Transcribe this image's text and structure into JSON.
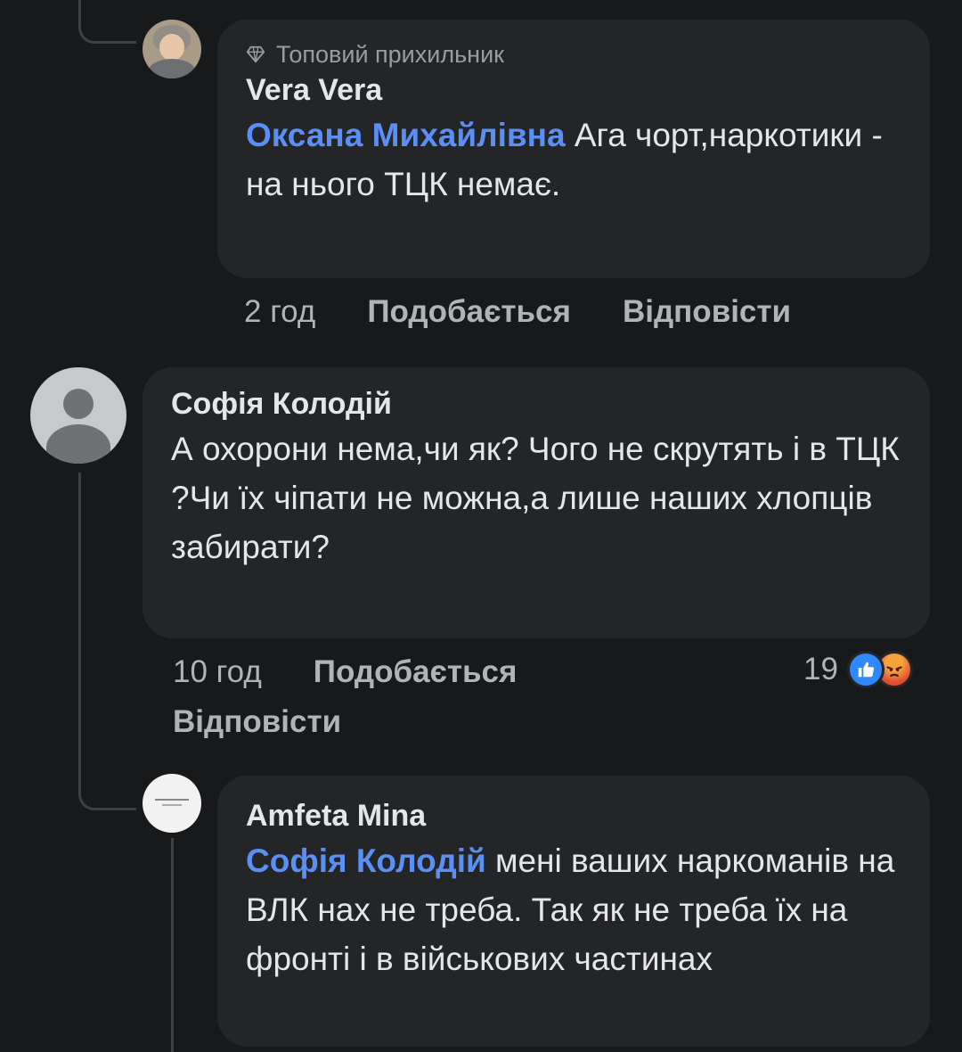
{
  "comments": [
    {
      "badge": "Топовий прихильник",
      "author": "Vera Vera",
      "mention": "Оксана Михайлівна",
      "text": " Ага чорт,наркотики  - на нього ТЦК немає.",
      "time": "2 год",
      "like_label": "Подобається",
      "reply_label": "Відповісти"
    },
    {
      "author": "Софія Колодій",
      "text": "А охорони нема,чи як? Чого не скрутять і в ТЦК ?Чи їх чіпати не можна,а лише наших хлопців забирати?",
      "time": "10 год",
      "like_label": "Подобається",
      "reply_label": "Відповісти",
      "reaction_count": "19",
      "reactions": [
        "like-icon",
        "angry-icon"
      ]
    },
    {
      "author": "Amfeta Mina",
      "mention": "Софія Колодій",
      "text": " мені ваших наркоманів на ВЛК нах не треба. Так як не треба їх на фронті і в військових частинах"
    }
  ],
  "colors": {
    "background": "#18191a",
    "bubble": "#242526",
    "mention": "#5b8ff5",
    "secondary_text": "#b0b3b8",
    "like_blue": "#2e89ff",
    "angry_orange": "#e8663d"
  }
}
